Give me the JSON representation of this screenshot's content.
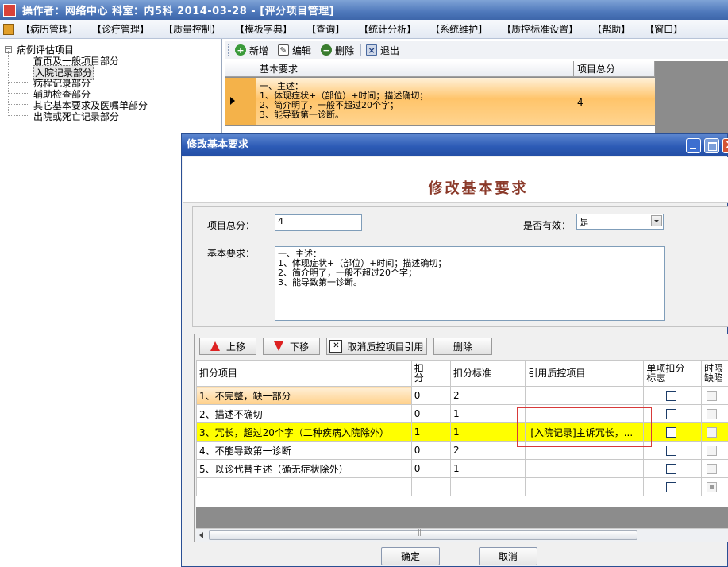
{
  "window": {
    "title": "操作者：网络中心   科室：内5科   2014-03-28 - [评分项目管理]"
  },
  "menu": [
    "【病历管理】",
    "【诊疗管理】",
    "【质量控制】",
    "【模板字典】",
    "【查询】",
    "【统计分析】",
    "【系统维护】",
    "【质控标准设置】",
    "【帮助】",
    "【窗口】"
  ],
  "tree": {
    "root": "病例评估项目",
    "items": [
      "首页及一般项目部分",
      "入院记录部分",
      "病程记录部分",
      "辅助检查部分",
      "其它基本要求及医嘱单部分",
      "出院或死亡记录部分"
    ],
    "selected_index": 1
  },
  "toolbar": {
    "add": "新增",
    "edit": "编辑",
    "delete": "删除",
    "exit": "退出"
  },
  "bg_grid": {
    "headers": [
      "基本要求",
      "项目总分"
    ],
    "row1_requirement": "一、主述：\n1、体现症状+（部位）+时间；描述确切；\n2、简介明了，一般不超过20个字；\n3、能导致第一诊断。",
    "row1_total": "4",
    "row2_partial": "一、主述："
  },
  "dialog": {
    "title": "修改基本要求",
    "heading": "修改基本要求",
    "total_label": "项目总分：",
    "total_value": "4",
    "valid_label": "是否有效：",
    "valid_value": "是",
    "req_label": "基本要求：",
    "req_value": "一、主述：\n1、体现症状+（部位）+时间；描述确切；\n2、简介明了，一般不超过20个字；\n3、能导致第一诊断。",
    "btn_up": "上移",
    "btn_down": "下移",
    "btn_cancel_ref": "取消质控项目引用",
    "btn_delete": "删除",
    "ok": "确定",
    "cancel": "取消"
  },
  "deduction_grid": {
    "columns": [
      "扣分项目",
      "扣分",
      "扣分标准",
      "引用质控项目",
      "单项扣分标志",
      "时限缺陷"
    ],
    "rows": [
      {
        "item": "1、不完整，缺一部分",
        "score": "0",
        "standard": "2",
        "ref": "",
        "single": false
      },
      {
        "item": "2、描述不确切",
        "score": "0",
        "standard": "1",
        "ref": "",
        "single": false
      },
      {
        "item": "3、冗长，超过20个字（二种疾病入院除外）",
        "score": "1",
        "standard": "1",
        "ref": "[入院记录]主诉冗长，...",
        "single": false
      },
      {
        "item": "4、不能导致第一诊断",
        "score": "0",
        "standard": "2",
        "ref": "",
        "single": false
      },
      {
        "item": "5、以诊代替主述（确无症状除外）",
        "score": "0",
        "standard": "1",
        "ref": "",
        "single": false
      },
      {
        "item": "",
        "score": "",
        "standard": "",
        "ref": "",
        "single": false
      }
    ]
  },
  "colors": {
    "title_bar": "#4e78bb",
    "selected_row": "#ffd08a",
    "highlight_row": "#ffff00",
    "annotation_box": "#d83a3a",
    "heading_text": "#8b3a2a"
  }
}
